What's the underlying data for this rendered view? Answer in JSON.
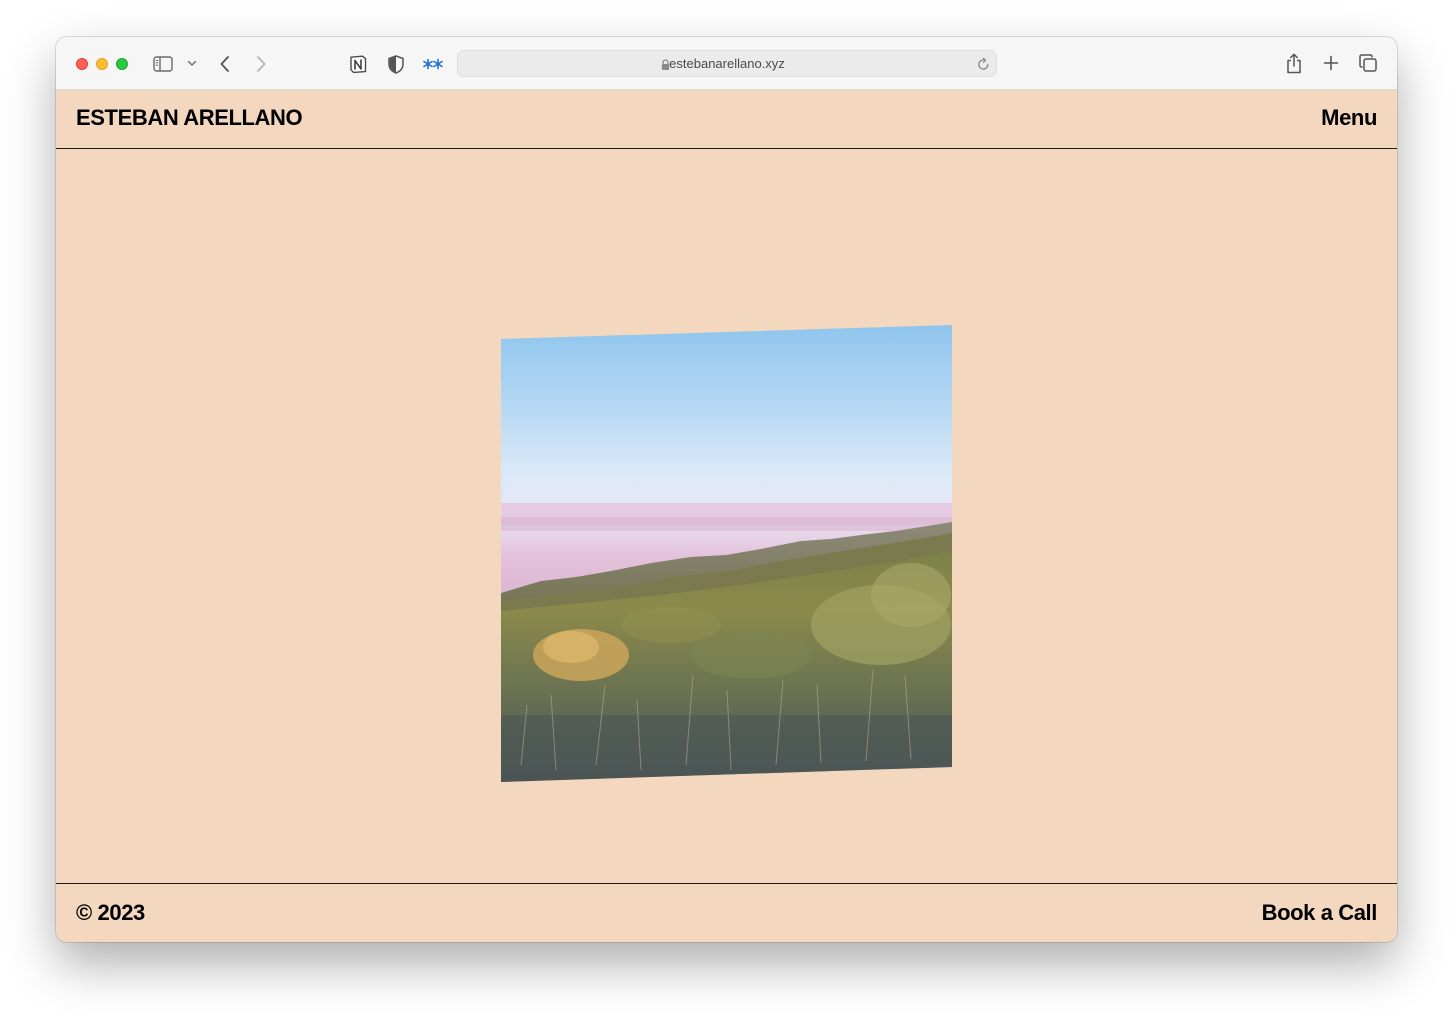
{
  "browser": {
    "url": "estebanarellano.xyz",
    "icons": {
      "sidebar": "sidebar-icon",
      "sidebar_menu": "chevron-down-icon",
      "back": "chevron-left-icon",
      "forward": "chevron-right-icon",
      "extension_1": "notion-icon",
      "extension_2": "shield-icon",
      "extension_3": "sparkle-icon",
      "lock": "lock-icon",
      "reload": "reload-icon",
      "share": "share-icon",
      "new_tab": "plus-icon",
      "tabs": "tabs-overview-icon"
    }
  },
  "header": {
    "brand": "ESTEBAN ARELLANO",
    "menu_label": "Menu"
  },
  "main": {
    "photo": "landscape-photo"
  },
  "footer": {
    "copyright": "© 2023",
    "cta_label": "Book a Call"
  },
  "colors": {
    "page_background": "#f3d7bf",
    "text": "#000000",
    "accent_extension": "#1f6fd6"
  }
}
